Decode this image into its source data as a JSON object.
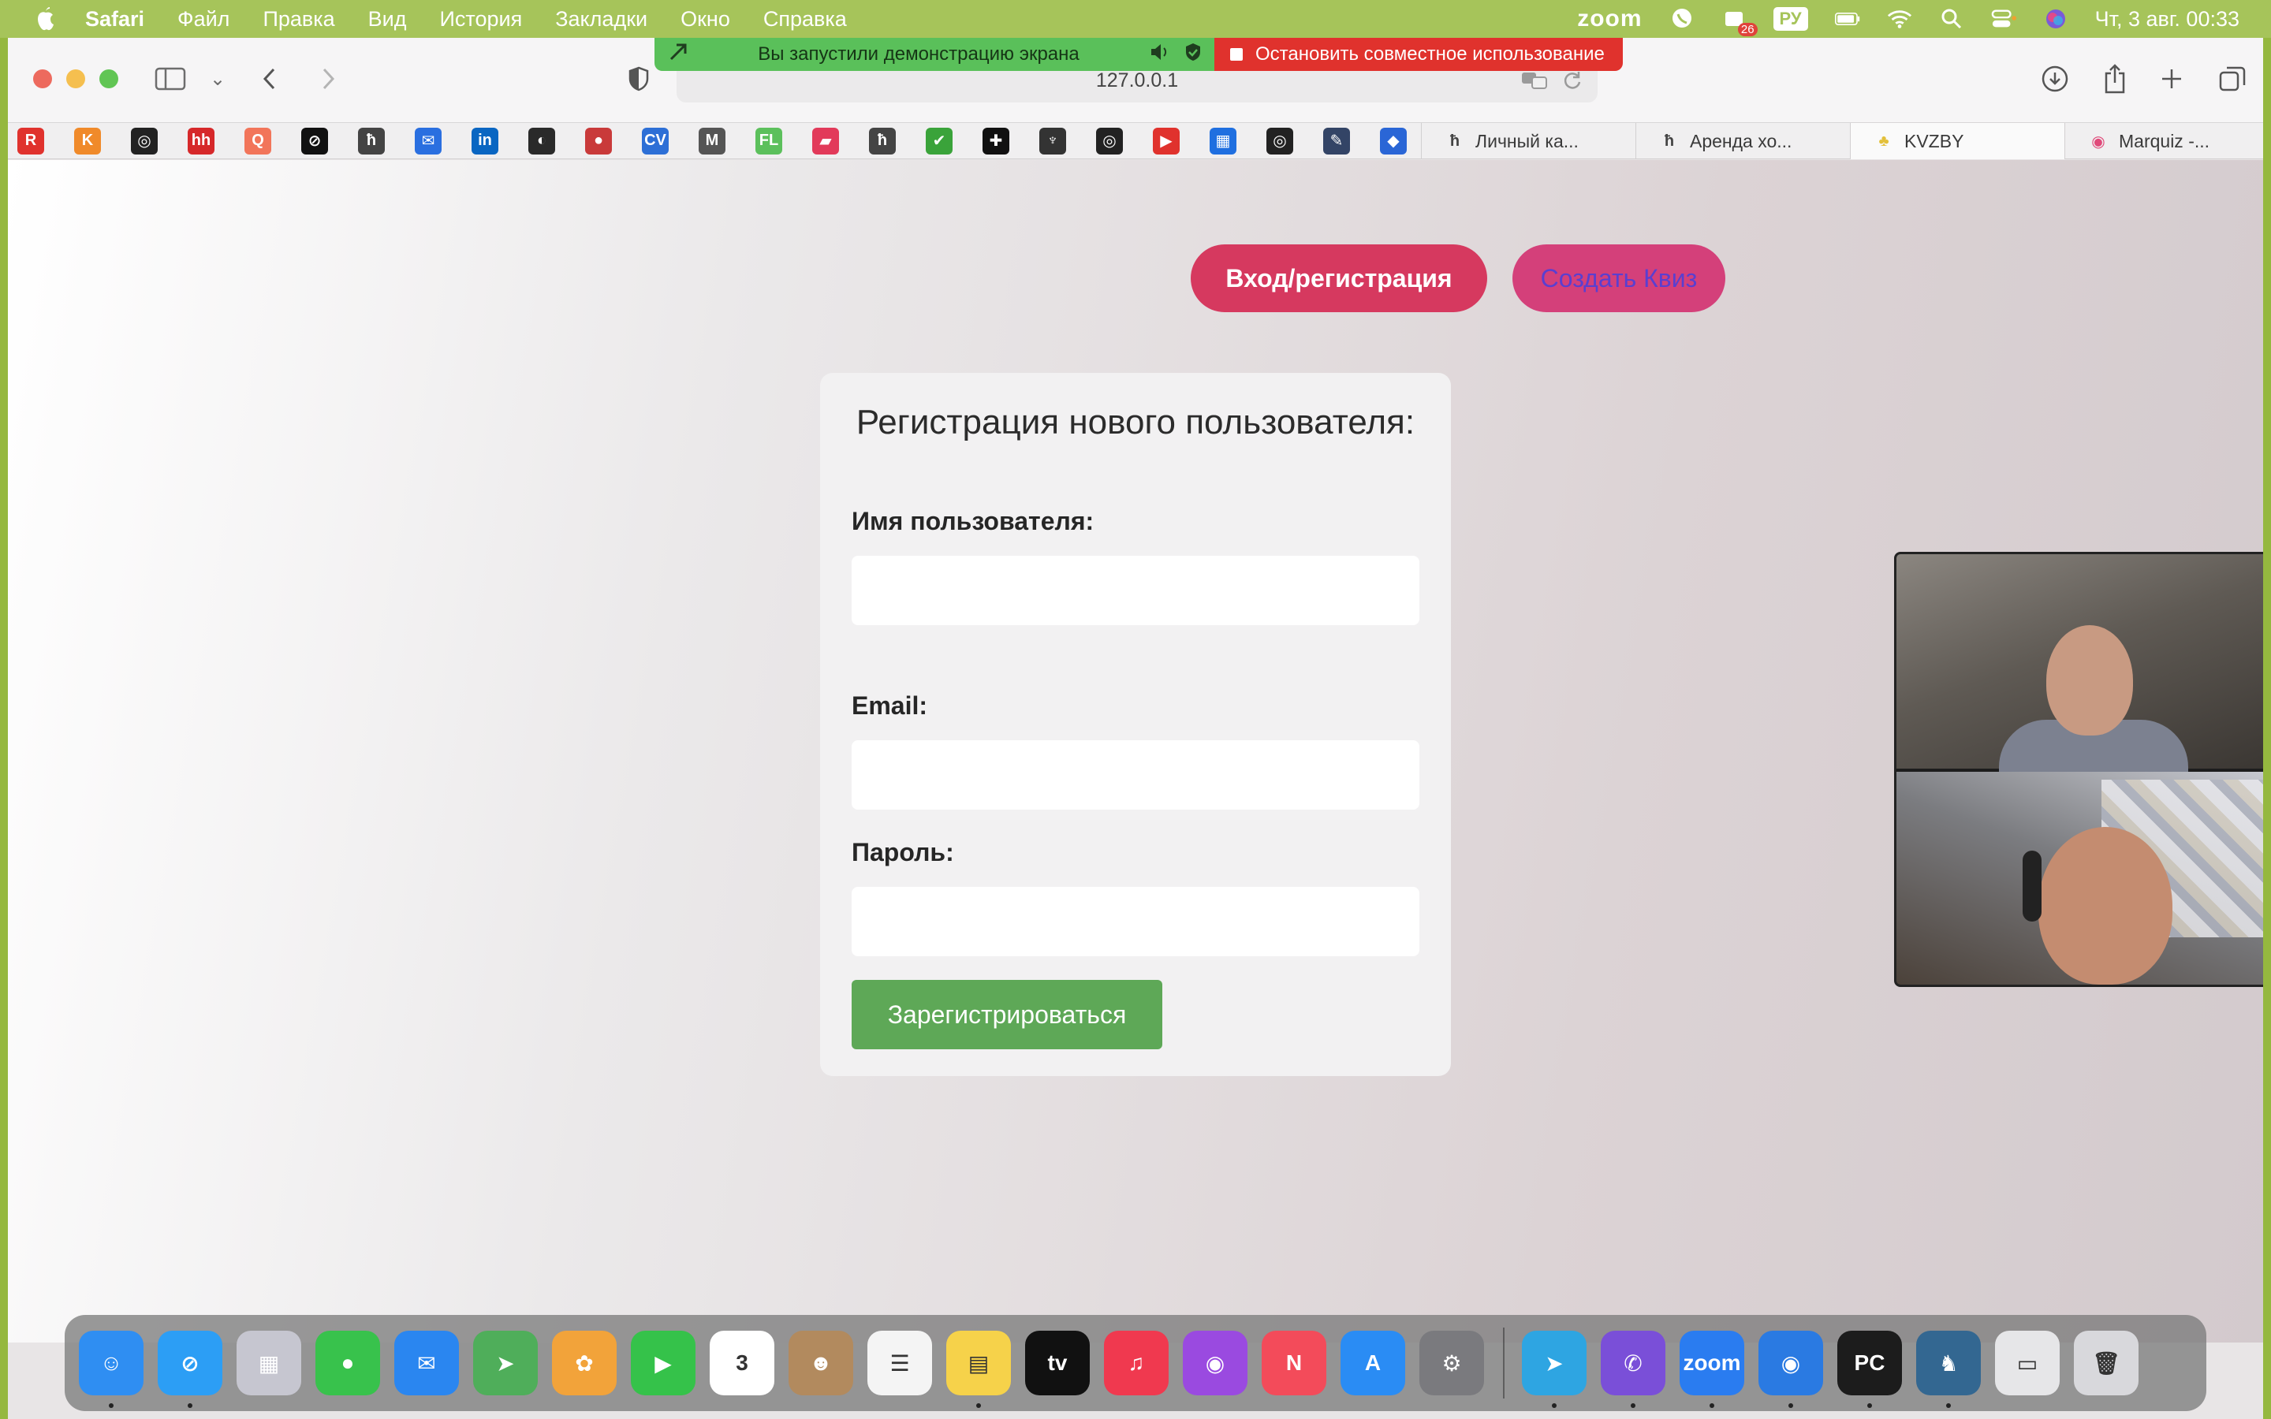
{
  "menubar": {
    "app_name": "Safari",
    "menu_items": [
      "Файл",
      "Правка",
      "Вид",
      "История",
      "Закладки",
      "Окно",
      "Справка"
    ],
    "zoom_label": "zoom",
    "notification_count": "26",
    "input_source": "РУ",
    "datetime": "Чт, 3 авг.  00:33"
  },
  "screen_share": {
    "status_text": "Вы запустили демонстрацию экрана",
    "stop_text": "Остановить совместное использование"
  },
  "browser": {
    "address": "127.0.0.1",
    "favorites": [
      {
        "icon": "R",
        "color": "#e0322d"
      },
      {
        "icon": "K",
        "color": "#f08a2a"
      },
      {
        "icon": "◎",
        "color": "#222222"
      },
      {
        "icon": "hh",
        "color": "#d6282a"
      },
      {
        "icon": "Q",
        "color": "#f2755a"
      },
      {
        "icon": "⊘",
        "color": "#111111"
      },
      {
        "icon": "ħ",
        "color": "#444444"
      },
      {
        "icon": "✉",
        "color": "#2a6fe0"
      },
      {
        "icon": "in",
        "color": "#0a66c2"
      },
      {
        "icon": "◐",
        "color": "#2a2a2a"
      },
      {
        "icon": "●",
        "color": "#c93a3a"
      },
      {
        "icon": "CV",
        "color": "#2d6fd6"
      },
      {
        "icon": "M",
        "color": "#555555"
      },
      {
        "icon": "FL",
        "color": "#5cc05c"
      },
      {
        "icon": "▰",
        "color": "#e23a5a"
      },
      {
        "icon": "ħ",
        "color": "#444444"
      },
      {
        "icon": "✔",
        "color": "#3aa33a"
      },
      {
        "icon": "✚",
        "color": "#111111"
      },
      {
        "icon": "♆",
        "color": "#333333"
      },
      {
        "icon": "◎",
        "color": "#222222"
      },
      {
        "icon": "▶",
        "color": "#e0322d"
      },
      {
        "icon": "▦",
        "color": "#1f6fe0"
      },
      {
        "icon": "◎",
        "color": "#222222"
      },
      {
        "icon": "✎",
        "color": "#334466"
      },
      {
        "icon": "◆",
        "color": "#2a66d6"
      }
    ],
    "tabs": [
      {
        "label": "Личный ка...",
        "icon": "ħ",
        "icon_color": "#444444"
      },
      {
        "label": "Аренда хо...",
        "icon": "ħ",
        "icon_color": "#444444"
      },
      {
        "label": "KVZBY",
        "icon": "♣",
        "icon_color": "#e3c03a"
      },
      {
        "label": "Marquiz -...",
        "icon": "◉",
        "icon_color": "#e04a7a"
      }
    ]
  },
  "page": {
    "login_button": "Вход/регистрация",
    "create_quiz_button": "Создать Квиз",
    "form": {
      "title": "Регистрация нового пользователя:",
      "username_label": "Имя пользователя:",
      "username_value": "",
      "email_label": "Email:",
      "email_value": "",
      "password_label": "Пароль:",
      "password_value": "",
      "submit_label": "Зарегистрироваться"
    }
  },
  "dock": {
    "apps": [
      {
        "name": "finder",
        "glyph": "☺",
        "color": "#2f8ef2",
        "running": true
      },
      {
        "name": "safari",
        "glyph": "⊘",
        "color": "#2c9ef5",
        "running": true
      },
      {
        "name": "launchpad",
        "glyph": "▦",
        "color": "#c6c6d0",
        "running": false
      },
      {
        "name": "messages",
        "glyph": "●",
        "color": "#38c24c",
        "running": false
      },
      {
        "name": "mail",
        "glyph": "✉",
        "color": "#2a86f0",
        "running": false
      },
      {
        "name": "maps",
        "glyph": "➤",
        "color": "#4fae5a",
        "running": false
      },
      {
        "name": "photos",
        "glyph": "✿",
        "color": "#f2a33a",
        "running": false
      },
      {
        "name": "facetime",
        "glyph": "▶",
        "color": "#35c24a",
        "running": false
      },
      {
        "name": "calendar",
        "glyph": "3",
        "color": "#ffffff",
        "running": false
      },
      {
        "name": "contacts",
        "glyph": "☻",
        "color": "#b28a5e",
        "running": false
      },
      {
        "name": "reminders",
        "glyph": "☰",
        "color": "#f4f4f4",
        "running": false
      },
      {
        "name": "notes",
        "glyph": "▤",
        "color": "#f6d24a",
        "running": true
      },
      {
        "name": "tv",
        "glyph": "tv",
        "color": "#111111",
        "running": false
      },
      {
        "name": "music",
        "glyph": "♫",
        "color": "#f0394f",
        "running": false
      },
      {
        "name": "podcasts",
        "glyph": "◉",
        "color": "#9a4ae0",
        "running": false
      },
      {
        "name": "news",
        "glyph": "N",
        "color": "#f34b5a",
        "running": false
      },
      {
        "name": "app-store",
        "glyph": "A",
        "color": "#2a8cf4",
        "running": false
      },
      {
        "name": "system-settings",
        "glyph": "⚙",
        "color": "#7a7a7e",
        "running": false
      }
    ],
    "apps_right": [
      {
        "name": "telegram",
        "glyph": "➤",
        "color": "#2ea5e2",
        "running": true
      },
      {
        "name": "viber",
        "glyph": "✆",
        "color": "#7a4fd8",
        "running": true
      },
      {
        "name": "zoom",
        "glyph": "zoom",
        "color": "#2a7cf0",
        "running": true
      },
      {
        "name": "anydesk",
        "glyph": "◉",
        "color": "#2a7ae2",
        "running": true
      },
      {
        "name": "pycharm",
        "glyph": "PC",
        "color": "#1c1c1c",
        "running": true
      },
      {
        "name": "postgresql",
        "glyph": "♞",
        "color": "#336791",
        "running": true
      },
      {
        "name": "screenshot-preview",
        "glyph": "▭",
        "color": "#e6e6e8",
        "running": false
      },
      {
        "name": "trash",
        "glyph": "🗑",
        "color": "#d8d8dc",
        "running": false
      }
    ]
  }
}
